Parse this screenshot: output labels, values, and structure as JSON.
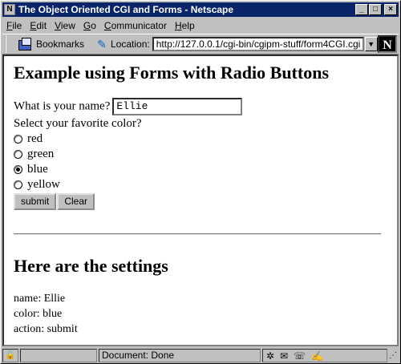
{
  "window": {
    "title": "The Object Oriented CGI and Forms - Netscape",
    "controls": {
      "minimize": "_",
      "maximize": "□",
      "close": "×"
    }
  },
  "menu": [
    "File",
    "Edit",
    "View",
    "Go",
    "Communicator",
    "Help"
  ],
  "toolbar": {
    "bookmarks_label": "Bookmarks",
    "location_label": "Location:",
    "url": "http://127.0.0.1/cgi-bin/cgipm-stuff/form4CGI.cgi"
  },
  "page": {
    "heading": "Example using Forms with Radio Buttons",
    "name_prompt": "What is your name?",
    "name_value": "Ellie",
    "color_prompt": "Select your favorite color?",
    "colors": [
      {
        "label": "red",
        "selected": false
      },
      {
        "label": "green",
        "selected": false
      },
      {
        "label": "blue",
        "selected": true
      },
      {
        "label": "yellow",
        "selected": false
      }
    ],
    "submit_label": "submit",
    "clear_label": "Clear",
    "settings_heading": "Here are the settings",
    "settings": {
      "name": "name: Ellie",
      "color": "color: blue",
      "action": "action: submit"
    }
  },
  "status": {
    "message": "Document: Done"
  }
}
